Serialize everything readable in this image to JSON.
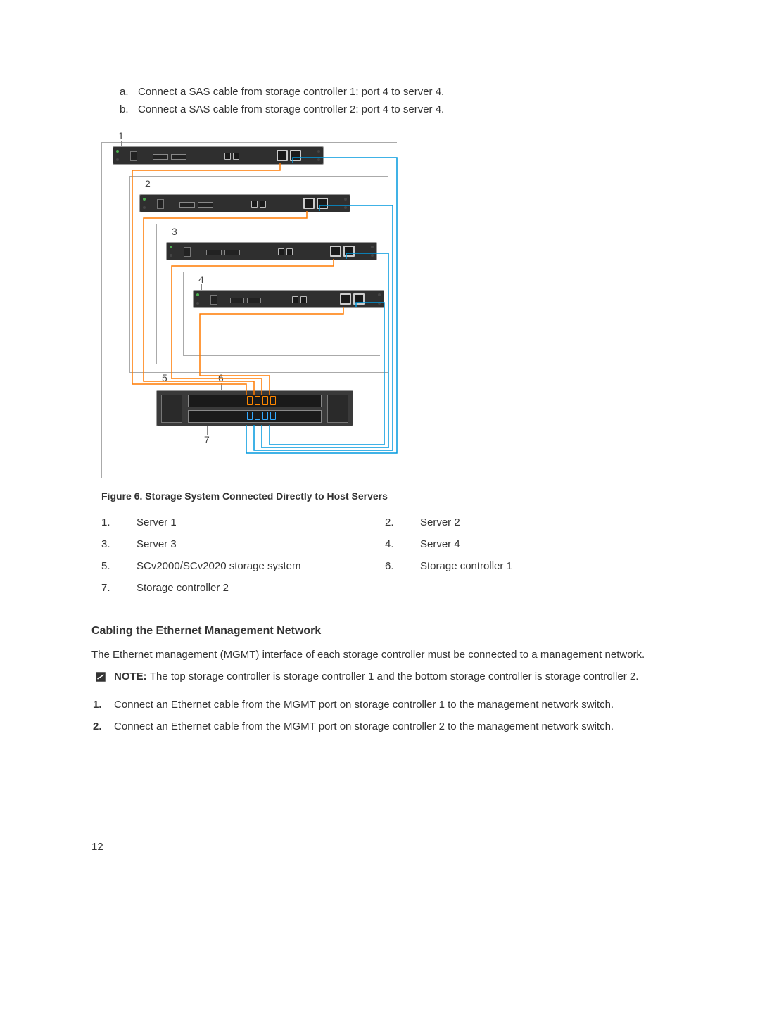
{
  "sub_list": [
    {
      "marker": "a.",
      "text": "Connect a SAS cable from storage controller 1: port 4 to server 4."
    },
    {
      "marker": "b.",
      "text": "Connect a SAS cable from storage controller 2: port 4 to server 4."
    }
  ],
  "figure": {
    "caption": "Figure 6. Storage System Connected Directly to Host Servers",
    "callouts": {
      "c1": "1",
      "c2": "2",
      "c3": "3",
      "c4": "4",
      "c5": "5",
      "c6": "6",
      "c7": "7"
    }
  },
  "legend": [
    {
      "num": "1.",
      "text": "Server 1"
    },
    {
      "num": "2.",
      "text": "Server 2"
    },
    {
      "num": "3.",
      "text": "Server 3"
    },
    {
      "num": "4.",
      "text": "Server 4"
    },
    {
      "num": "5.",
      "text": "SCv2000/SCv2020 storage system"
    },
    {
      "num": "6.",
      "text": "Storage controller 1"
    },
    {
      "num": "7.",
      "text": "Storage controller 2"
    }
  ],
  "section": {
    "heading": "Cabling the Ethernet Management Network",
    "intro": "The Ethernet management (MGMT) interface of each storage controller must be connected to a management network."
  },
  "note": {
    "label": "NOTE: ",
    "text": "The top storage controller is storage controller 1 and the bottom storage controller is storage controller 2."
  },
  "steps": [
    {
      "num": "1.",
      "text": "Connect an Ethernet cable from the MGMT port on storage controller 1 to the management network switch."
    },
    {
      "num": "2.",
      "text": "Connect an Ethernet cable from the MGMT port on storage controller 2 to the management network switch."
    }
  ],
  "page_number": "12"
}
